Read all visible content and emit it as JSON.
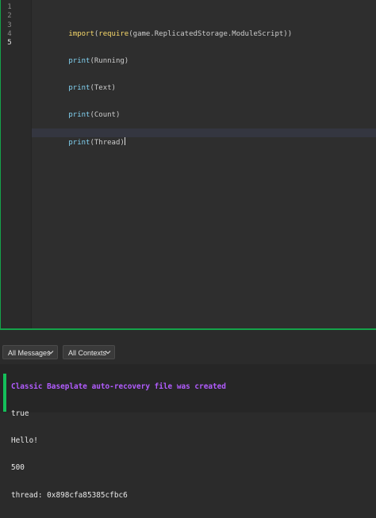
{
  "editor": {
    "line_numbers": [
      "1",
      "2",
      "3",
      "4",
      "5"
    ],
    "lines": [
      {
        "tokens": [
          {
            "t": "import",
            "c": "kw"
          },
          {
            "t": "(",
            "c": "id"
          },
          {
            "t": "require",
            "c": "kw"
          },
          {
            "t": "(game.ReplicatedStorage.ModuleScript))",
            "c": "id"
          }
        ]
      },
      {
        "tokens": [
          {
            "t": "print",
            "c": "fn"
          },
          {
            "t": "(Running)",
            "c": "id"
          }
        ]
      },
      {
        "tokens": [
          {
            "t": "print",
            "c": "fn"
          },
          {
            "t": "(Text)",
            "c": "id"
          }
        ]
      },
      {
        "tokens": [
          {
            "t": "print",
            "c": "fn"
          },
          {
            "t": "(Count)",
            "c": "id"
          }
        ]
      },
      {
        "tokens": [
          {
            "t": "print",
            "c": "fn"
          },
          {
            "t": "(Thread)",
            "c": "id"
          }
        ]
      }
    ],
    "current_line": 5
  },
  "output": {
    "filters": {
      "messages_label": "All Messages",
      "contexts_label": "All Contexts"
    },
    "messages": [
      {
        "text": "Classic Baseplate auto-recovery file was created",
        "kind": "info"
      },
      {
        "text": "true",
        "kind": "out"
      },
      {
        "text": "Hello!",
        "kind": "out"
      },
      {
        "text": "500",
        "kind": "out"
      },
      {
        "text": "thread: 0x898cfa85385cfbc6",
        "kind": "out"
      }
    ]
  },
  "colors": {
    "accent": "#15a34a",
    "keyword": "#f8d96a",
    "builtin": "#84d6f7",
    "info_message": "#b25cff"
  }
}
